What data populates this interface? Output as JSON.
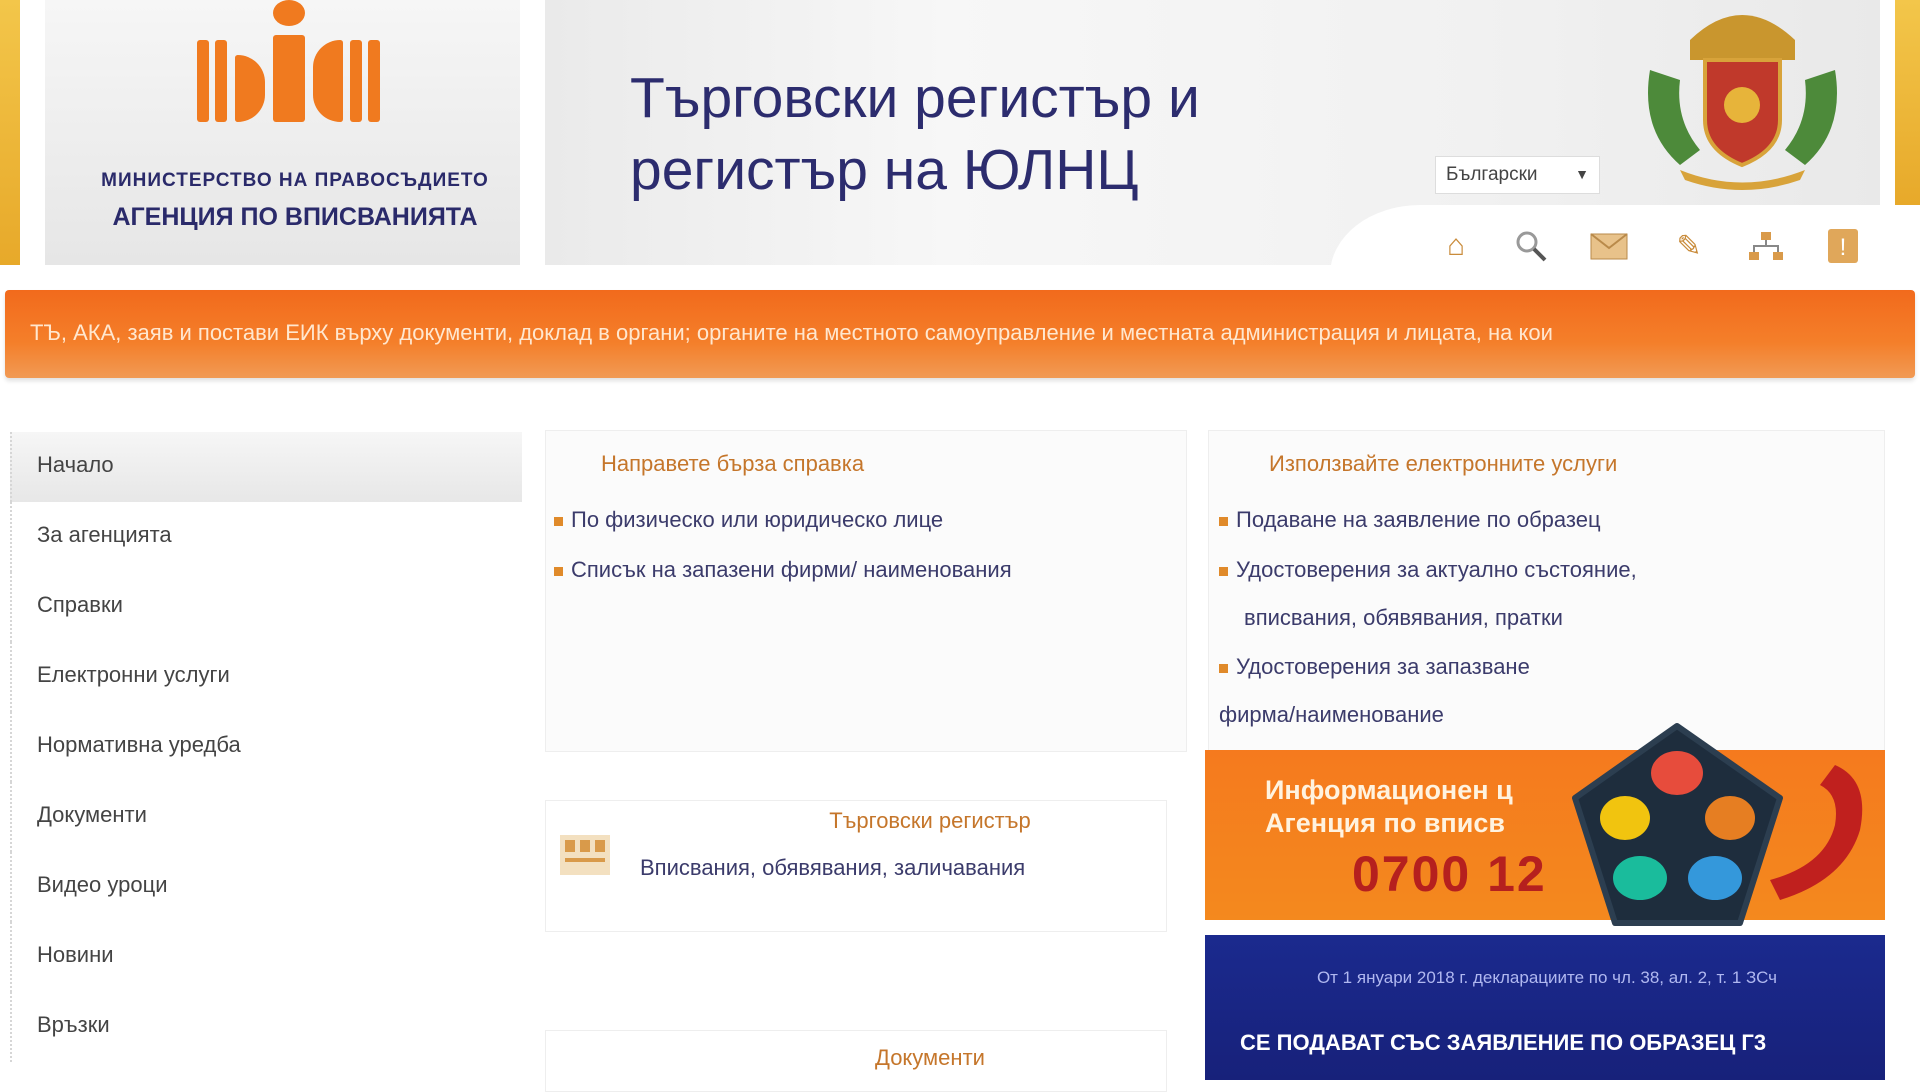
{
  "header": {
    "ministry_line1": "МИНИСТЕРСТВО НА ПРАВОСЪДИЕТО",
    "ministry_line2": "АГЕНЦИЯ ПО ВПИСВАНИЯТА",
    "site_title_line1": "Търговски регистър и",
    "site_title_line2": "регистър на ЮЛНЦ",
    "language_selected": "Български",
    "toolbar_icons": [
      "home-icon",
      "search-icon",
      "mail-icon",
      "settings-icon",
      "sitemap-icon",
      "help-icon"
    ]
  },
  "ticker": {
    "text": "ТЪ, АКА, заяв и постави ЕИК върху документи, доклад в органи; органите на местното самоуправление и местната администрация и лицата, на кои"
  },
  "sidebar": {
    "items": [
      {
        "label": "Начало",
        "active": true
      },
      {
        "label": "За агенцията",
        "active": false
      },
      {
        "label": "Справки",
        "active": false
      },
      {
        "label": "Електронни услуги",
        "active": false
      },
      {
        "label": "Нормативна уредба",
        "active": false
      },
      {
        "label": "Документи",
        "active": false
      },
      {
        "label": "Видео уроци",
        "active": false
      },
      {
        "label": "Новини",
        "active": false
      },
      {
        "label": "Връзки",
        "active": false
      }
    ]
  },
  "main": {
    "reference": {
      "heading": "Направете бърза справка",
      "items": [
        "По физическо или юридическо лице",
        "Списък на запазени фирми/ наименования"
      ]
    },
    "eservices": {
      "heading": "Използвайте електронните услуги",
      "items": [
        "Подаване на заявление по образец",
        "Удостоверения за актуално състояние,",
        "вписвания, обявявания, пратки",
        "Удостоверения за запазване",
        "фирма/наименование"
      ]
    },
    "trade_register": {
      "title": "Търговски регистър",
      "subtitle": "Вписвания, обявявания, заличавания"
    },
    "documents": {
      "title": "Документи"
    }
  },
  "info_banner": {
    "line1": "Информационен ц",
    "line2": "Агенция по вписв",
    "phone": "0700 12"
  },
  "notice": {
    "line1": "От 1 януари 2018 г. декларациите по чл. 38, ал. 2, т. 1 ЗСч",
    "line2": "СЕ ПОДАВАТ СЪС ЗАЯВЛЕНИЕ ПО ОБРАЗЕЦ Г3"
  },
  "colors": {
    "brand_orange": "#f26a1c",
    "title_navy": "#2c2c6e",
    "notice_blue": "#1b2a8e",
    "phone_red": "#b5201e"
  }
}
